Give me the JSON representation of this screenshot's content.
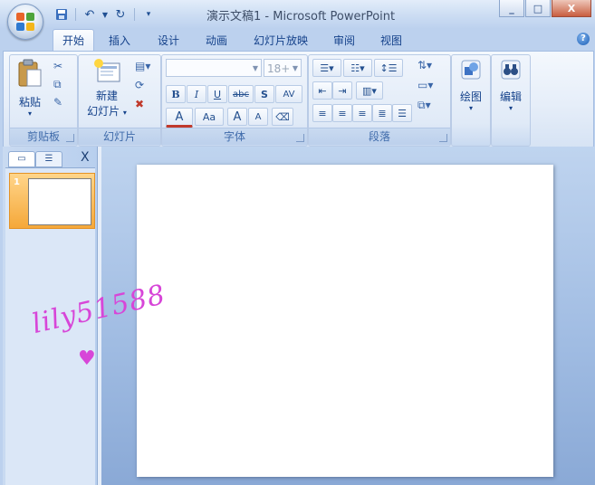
{
  "window": {
    "title": "演示文稿1 - Microsoft PowerPoint",
    "controls": {
      "minimize": "_",
      "maximize": "□",
      "close": "X"
    }
  },
  "qat": {
    "save_icon": "save-icon",
    "undo_icon": "undo-icon",
    "redo_icon": "redo-icon",
    "customize_icon": "customize-arrow-icon"
  },
  "tabs": [
    {
      "label": "开始",
      "active": true
    },
    {
      "label": "插入"
    },
    {
      "label": "设计"
    },
    {
      "label": "动画"
    },
    {
      "label": "幻灯片放映"
    },
    {
      "label": "审阅"
    },
    {
      "label": "视图"
    }
  ],
  "ribbon": {
    "clipboard": {
      "label": "剪贴板",
      "paste": "粘贴"
    },
    "slides": {
      "label": "幻灯片",
      "new_slide_line1": "新建",
      "new_slide_line2": "幻灯片"
    },
    "font": {
      "label": "字体",
      "font_size": "18+",
      "bold": "B",
      "italic": "I",
      "underline": "U",
      "strike": "abc",
      "shadow": "S",
      "spacing": "AV",
      "color": "A",
      "case": "Aa",
      "grow": "A",
      "shrink": "A"
    },
    "paragraph": {
      "label": "段落"
    },
    "drawing": {
      "label": "绘图"
    },
    "editing": {
      "label": "编辑"
    }
  },
  "panel": {
    "slide_number": "1",
    "close": "X"
  },
  "watermark": {
    "text": "lily51588",
    "heart": "♥"
  },
  "colors": {
    "accent": "#15428b",
    "selected_thumb": "#f5a83a",
    "watermark": "#d746d8"
  }
}
